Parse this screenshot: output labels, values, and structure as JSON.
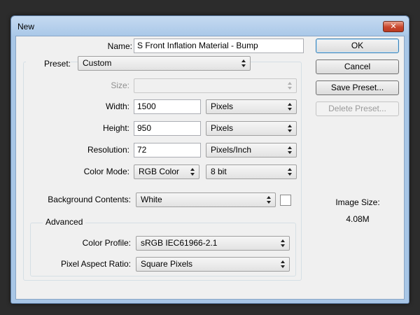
{
  "window": {
    "title": "New",
    "close_glyph": "✕"
  },
  "form": {
    "name_label": "Name:",
    "name_value": "S Front Inflation Material - Bump",
    "preset_label": "Preset:",
    "preset_value": "Custom",
    "size_label": "Size:",
    "size_value": "",
    "width_label": "Width:",
    "width_value": "1500",
    "width_unit": "Pixels",
    "height_label": "Height:",
    "height_value": "950",
    "height_unit": "Pixels",
    "resolution_label": "Resolution:",
    "resolution_value": "72",
    "resolution_unit": "Pixels/Inch",
    "color_mode_label": "Color Mode:",
    "color_mode_value": "RGB Color",
    "bit_depth_value": "8 bit",
    "background_label": "Background Contents:",
    "background_value": "White",
    "background_swatch_color": "#ffffff"
  },
  "advanced": {
    "title": "Advanced",
    "color_profile_label": "Color Profile:",
    "color_profile_value": "sRGB IEC61966-2.1",
    "pixel_aspect_label": "Pixel Aspect Ratio:",
    "pixel_aspect_value": "Square Pixels"
  },
  "buttons": {
    "ok": "OK",
    "cancel": "Cancel",
    "save_preset": "Save Preset...",
    "delete_preset": "Delete Preset..."
  },
  "image_size": {
    "label": "Image Size:",
    "value": "4.08M"
  },
  "colors": {
    "titlebar": "#aac8e8",
    "dialog_bg": "#f0f0f0",
    "close_button": "#c9462c",
    "default_button_border": "#3c7fb1"
  }
}
